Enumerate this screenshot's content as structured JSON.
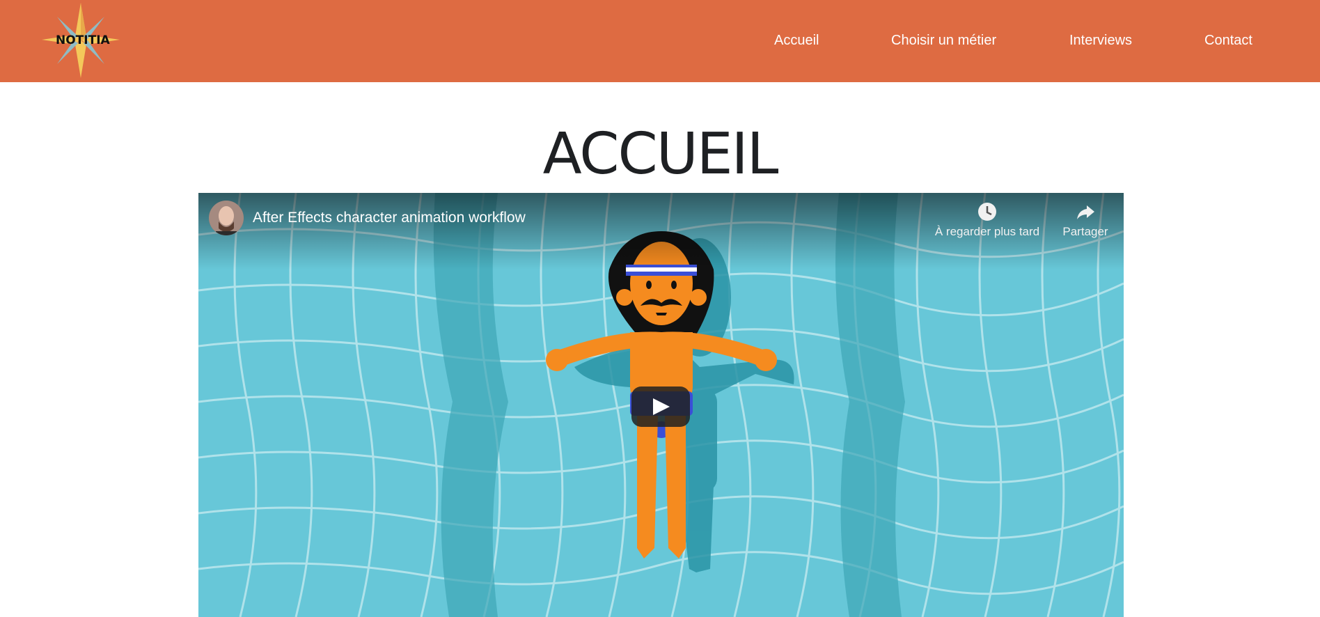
{
  "header": {
    "logo_text": "NOTITIA",
    "brand_color": "#de6b42",
    "nav": [
      {
        "label": "Accueil"
      },
      {
        "label": "Choisir un métier"
      },
      {
        "label": "Interviews"
      },
      {
        "label": "Contact"
      }
    ]
  },
  "page": {
    "title": "ACCUEIL"
  },
  "video": {
    "title": "After Effects character animation workflow",
    "watch_later_label": "À regarder plus tard",
    "share_label": "Partager",
    "icons": {
      "watch_later": "clock-icon",
      "share": "share-arrow-icon",
      "play": "play-icon"
    }
  }
}
